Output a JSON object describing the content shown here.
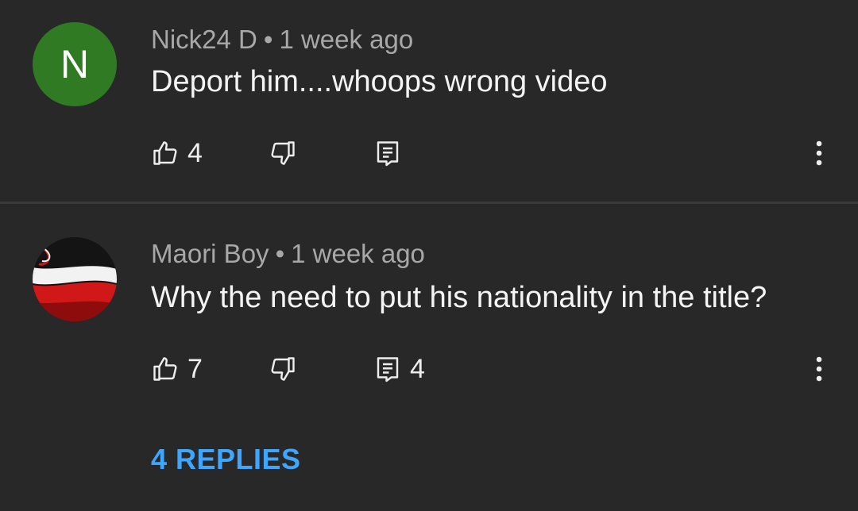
{
  "comments": [
    {
      "avatar_letter": "N",
      "avatar_color": "#2f7a22",
      "author": "Nick24 D",
      "separator": "•",
      "time": "1 week ago",
      "text": "Deport him....whoops wrong video",
      "likes": "4",
      "replies_count": ""
    },
    {
      "avatar_description": "flag-avatar",
      "author": "Maori Boy",
      "separator": "•",
      "time": "1 week ago",
      "text": "Why the need to put his nationality in the title?",
      "likes": "7",
      "replies_count": "4",
      "replies_link": "4 REPLIES"
    }
  ],
  "colors": {
    "background": "#282828",
    "link": "#3ea6ff"
  },
  "icons": [
    "thumbs-up-icon",
    "thumbs-down-icon",
    "reply-icon",
    "more-vert-icon"
  ]
}
